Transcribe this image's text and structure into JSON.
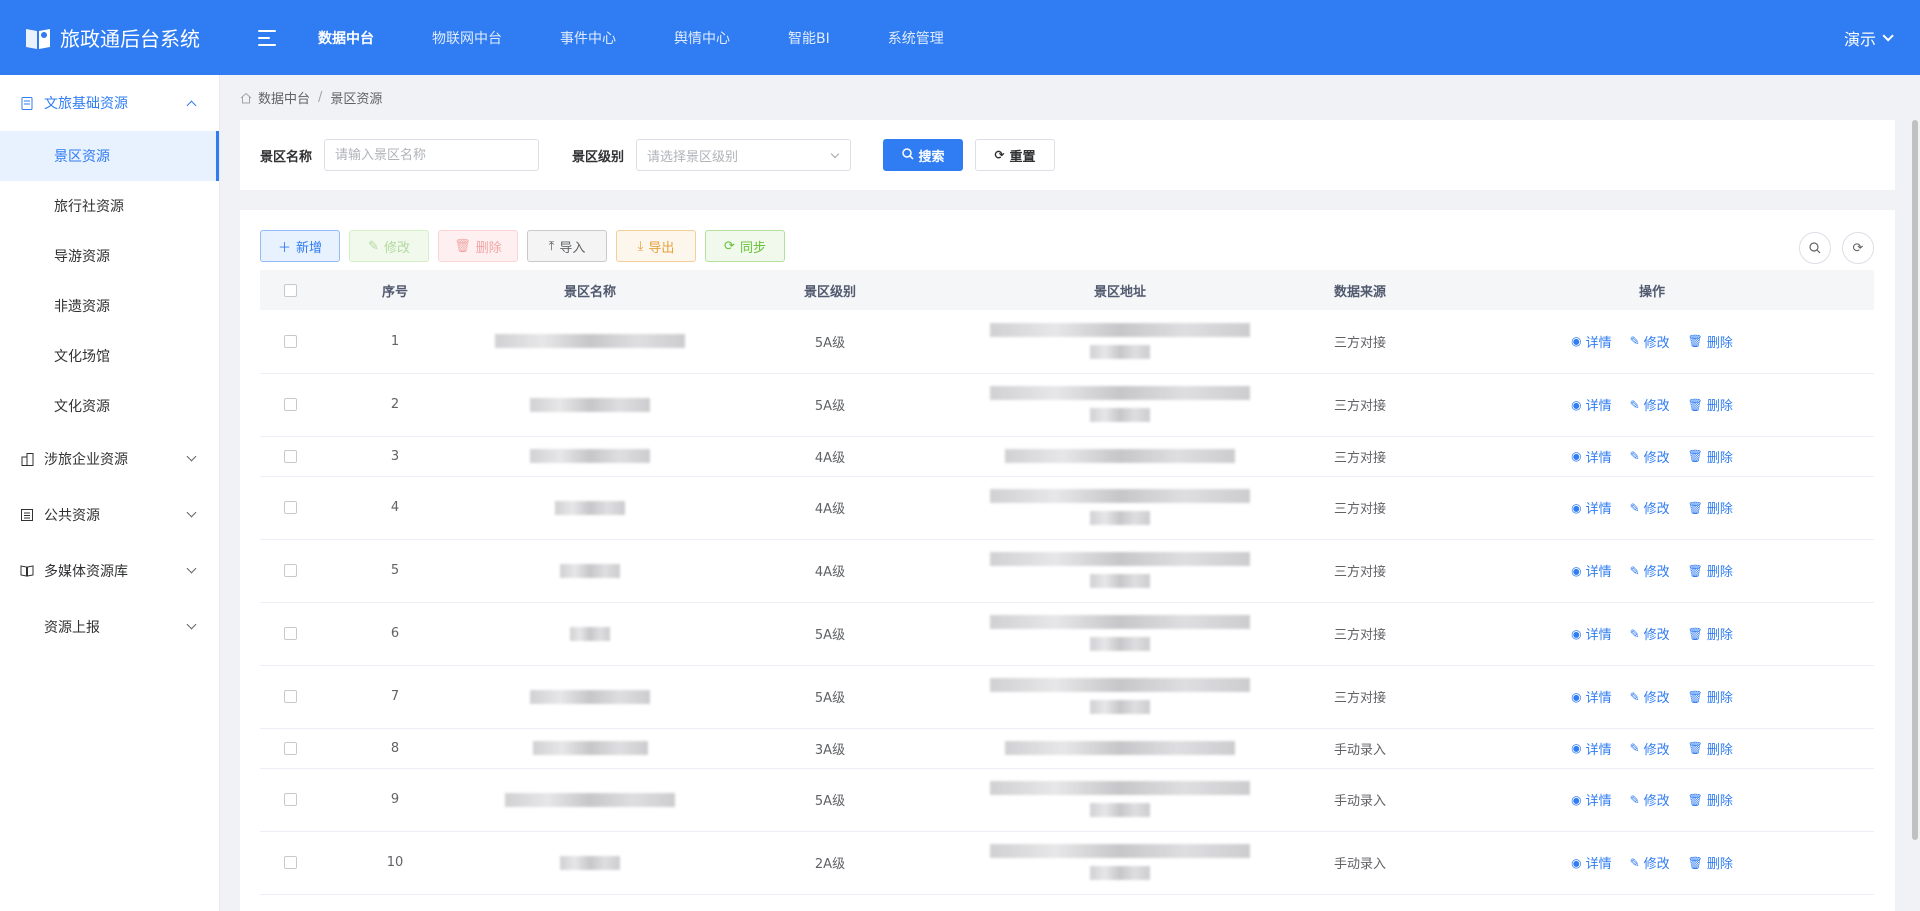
{
  "header": {
    "app_title": "旅政通后台系统",
    "nav": [
      {
        "label": "数据中台",
        "active": true
      },
      {
        "label": "物联网中台",
        "active": false
      },
      {
        "label": "事件中心",
        "active": false
      },
      {
        "label": "舆情中心",
        "active": false
      },
      {
        "label": "智能BI",
        "active": false
      },
      {
        "label": "系统管理",
        "active": false
      }
    ],
    "user": "演示"
  },
  "sidebar": {
    "group_cultural": "文旅基础资源",
    "sub_items": [
      "景区资源",
      "旅行社资源",
      "导游资源",
      "非遗资源",
      "文化场馆",
      "文化资源"
    ],
    "group_enterprise": "涉旅企业资源",
    "group_public": "公共资源",
    "group_media": "多媒体资源库",
    "group_report": "资源上报"
  },
  "breadcrumb": [
    "数据中台",
    "景区资源"
  ],
  "search": {
    "name_label": "景区名称",
    "name_placeholder": "请输入景区名称",
    "level_label": "景区级别",
    "level_placeholder": "请选择景区级别",
    "search_btn": "搜索",
    "reset_btn": "重置"
  },
  "toolbar": {
    "add": "新增",
    "edit": "修改",
    "delete": "删除",
    "import": "导入",
    "export": "导出",
    "sync": "同步"
  },
  "table": {
    "columns": [
      "序号",
      "景区名称",
      "景区级别",
      "景区地址",
      "数据来源",
      "操作"
    ],
    "ops": {
      "detail": "详情",
      "edit": "修改",
      "delete": "删除"
    },
    "rows": [
      {
        "no": "1",
        "level": "5A级",
        "source": "三方对接"
      },
      {
        "no": "2",
        "level": "5A级",
        "source": "三方对接"
      },
      {
        "no": "3",
        "level": "4A级",
        "source": "三方对接"
      },
      {
        "no": "4",
        "level": "4A级",
        "source": "三方对接"
      },
      {
        "no": "5",
        "level": "4A级",
        "source": "三方对接"
      },
      {
        "no": "6",
        "level": "5A级",
        "source": "三方对接"
      },
      {
        "no": "7",
        "level": "5A级",
        "source": "三方对接"
      },
      {
        "no": "8",
        "level": "3A级",
        "source": "手动录入"
      },
      {
        "no": "9",
        "level": "5A级",
        "source": "手动录入"
      },
      {
        "no": "10",
        "level": "2A级",
        "source": "手动录入"
      }
    ]
  },
  "colors": {
    "primary": "#2f7cf3",
    "success": "#67c23a",
    "warning": "#e6a23c",
    "danger": "#f56c6c"
  }
}
